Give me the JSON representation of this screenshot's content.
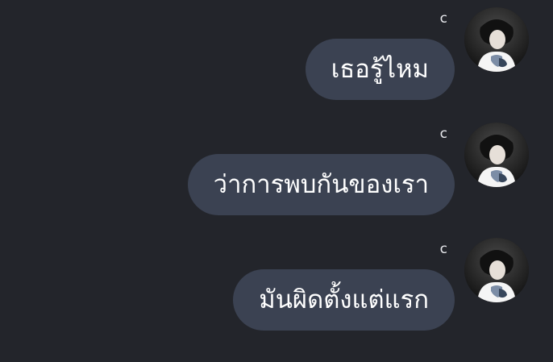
{
  "chat": {
    "messages": [
      {
        "sender": "c",
        "text": "เธอรู้ไหม",
        "avatar": "avatar-icon"
      },
      {
        "sender": "c",
        "text": "ว่าการพบกันของเรา",
        "avatar": "avatar-icon"
      },
      {
        "sender": "c",
        "text": "มันผิดตั้งแต่แรก",
        "avatar": "avatar-icon"
      }
    ]
  },
  "theme": {
    "background": "#23252b",
    "bubble": "#3b4252",
    "text": "#ffffff"
  }
}
